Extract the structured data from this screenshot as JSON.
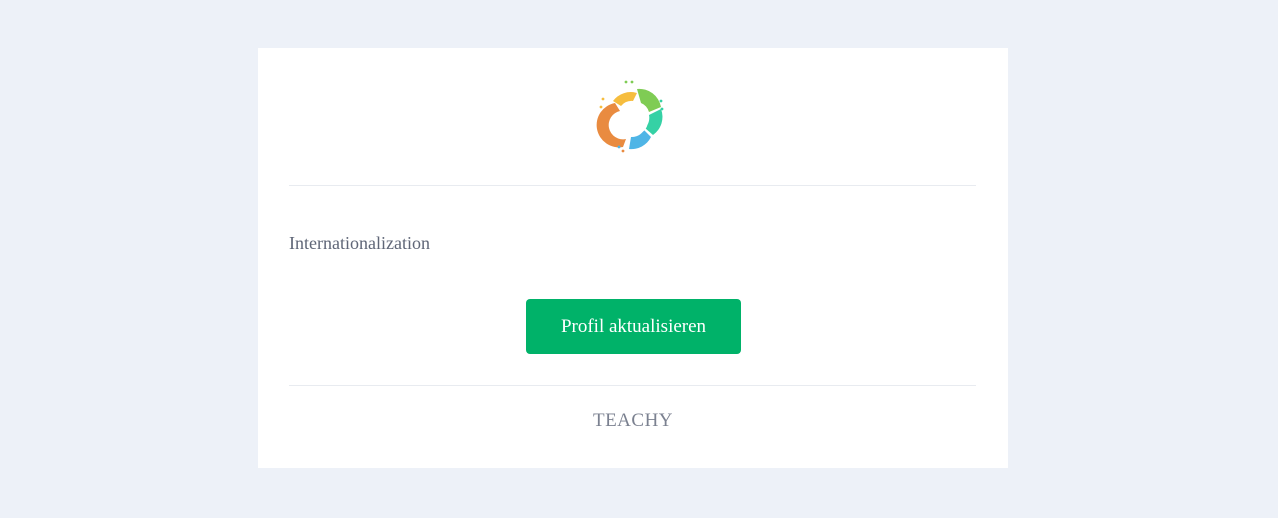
{
  "email": {
    "logo_icon": "teachy-ring-logo",
    "body_text": "Internationalization",
    "button_label": "Profil aktualisieren",
    "footer_brand": "TEACHY"
  },
  "colors": {
    "background": "#edf1f8",
    "card": "#ffffff",
    "button": "#00b269",
    "body_text": "#5f6677",
    "footer_text": "#7b8190",
    "logo_orange": "#e98b40",
    "logo_yellow": "#f6bd3e",
    "logo_green": "#7fcc54",
    "logo_teal": "#35d1a5",
    "logo_blue": "#4fb5e6"
  }
}
